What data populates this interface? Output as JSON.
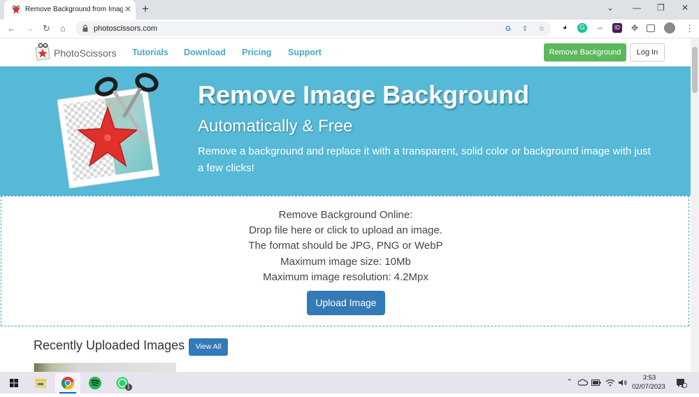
{
  "browser": {
    "tab_title": "Remove Background from Image",
    "tab_close": "✕",
    "new_tab": "+",
    "url": "photoscissors.com",
    "window_controls": {
      "minimize": "—",
      "restore": "❐",
      "close": "✕",
      "tab_search": "⌄"
    },
    "nav": {
      "back": "←",
      "forward": "→",
      "reload": "↻",
      "home": "⌂",
      "menu": "⋮"
    },
    "toolbar_icons": [
      "google-icon",
      "share-icon",
      "star-icon",
      "panda-extension-icon",
      "grammarly-icon",
      "cloud-extension-icon",
      "ad-extension-icon",
      "puzzle-icon",
      "sidepanel-icon",
      "profile-avatar-icon"
    ]
  },
  "site": {
    "logo_text": "PhotoScissors",
    "nav_links": [
      "Tutorials",
      "Download",
      "Pricing",
      "Support"
    ],
    "remove_bg_label": "Remove Background",
    "login_label": "Log In",
    "accent": "#55b9d7",
    "green": "#5cb85c",
    "blue": "#337ab7"
  },
  "hero": {
    "title": "Remove Image Background",
    "subtitle": "Automatically & Free",
    "description": "Remove a background and replace it with a transparent, solid color or background image with just a few clicks!"
  },
  "dropzone": {
    "heading": "Remove Background Online:",
    "lines": [
      "Drop file here or click to upload an image.",
      "The format should be JPG, PNG or WebP",
      "Maximum image size: 10Mb",
      "Maximum image resolution: 4.2Mpx"
    ],
    "upload_label": "Upload Image"
  },
  "recent": {
    "title": "Recently Uploaded Images",
    "view_all_label": "View All"
  },
  "taskbar": {
    "apps": [
      "windows-start-icon",
      "file-explorer-icon",
      "chrome-icon",
      "spotify-icon",
      "whatsapp-icon"
    ],
    "whatsapp_badge": "1",
    "tray_chevron": "⌃",
    "time": "3:53",
    "date": "02/07/2023",
    "notification_count": "4"
  }
}
